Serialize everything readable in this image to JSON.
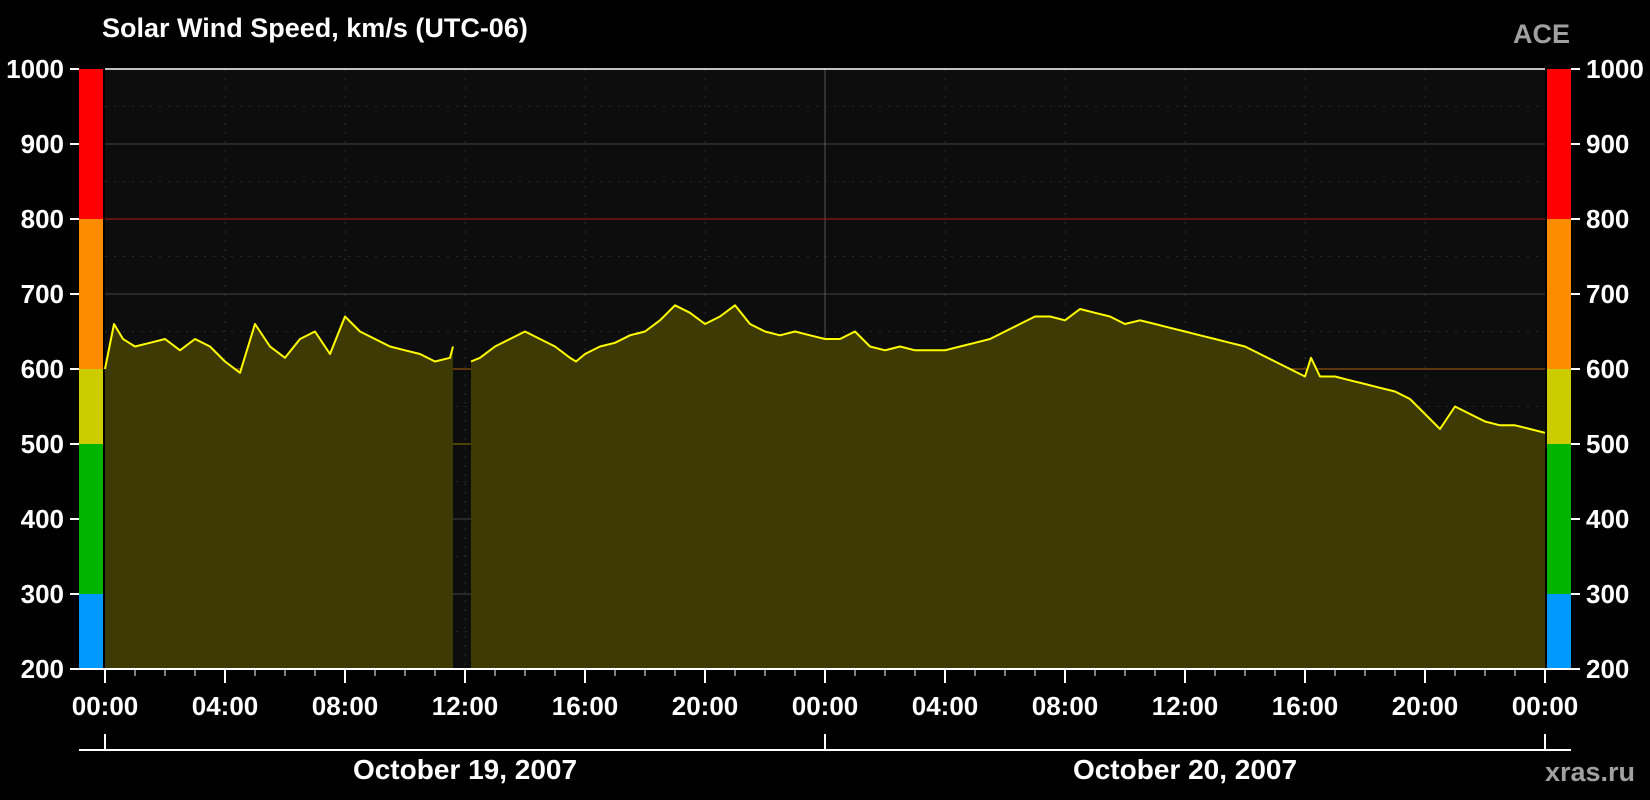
{
  "header": {
    "title": "Solar Wind Speed, km/s (UTC-06)",
    "source": "ACE"
  },
  "footer": {
    "credit": "xras.ru"
  },
  "chart_data": {
    "type": "area",
    "title": "Solar Wind Speed, km/s (UTC-06)",
    "ylim": [
      200,
      1000
    ],
    "y_ticks": [
      "200",
      "300",
      "400",
      "500",
      "600",
      "700",
      "800",
      "900",
      "1000"
    ],
    "x_range_hours": [
      0,
      48
    ],
    "x_ticks": [
      {
        "h": 0,
        "label": "00:00"
      },
      {
        "h": 4,
        "label": "04:00"
      },
      {
        "h": 8,
        "label": "08:00"
      },
      {
        "h": 12,
        "label": "12:00"
      },
      {
        "h": 16,
        "label": "16:00"
      },
      {
        "h": 20,
        "label": "20:00"
      },
      {
        "h": 24,
        "label": "00:00"
      },
      {
        "h": 28,
        "label": "04:00"
      },
      {
        "h": 32,
        "label": "08:00"
      },
      {
        "h": 36,
        "label": "12:00"
      },
      {
        "h": 40,
        "label": "16:00"
      },
      {
        "h": 44,
        "label": "20:00"
      },
      {
        "h": 48,
        "label": "00:00"
      }
    ],
    "dates": [
      {
        "label": "October 19, 2007",
        "start_h": 0,
        "end_h": 24
      },
      {
        "label": "October 20, 2007",
        "start_h": 24,
        "end_h": 48
      }
    ],
    "grid": true,
    "level_bands": [
      {
        "from": 200,
        "to": 300,
        "color": "#0099ff"
      },
      {
        "from": 300,
        "to": 500,
        "color": "#00b400"
      },
      {
        "from": 500,
        "to": 600,
        "color": "#cccc00"
      },
      {
        "from": 600,
        "to": 800,
        "color": "#ff8c00"
      },
      {
        "from": 800,
        "to": 1000,
        "color": "#ff0000"
      }
    ],
    "threshold_lines": [
      {
        "value": 500,
        "color": "#8a7a00"
      },
      {
        "value": 600,
        "color": "#b06010"
      },
      {
        "value": 800,
        "color": "#b01818"
      }
    ],
    "colors": {
      "line": "#ffff00",
      "fill": "#3d3a05",
      "plot_bg": "#0d0d0d",
      "grid": "#444444"
    },
    "series": [
      {
        "data_hours": [
          0,
          0.3,
          0.6,
          1.0,
          1.5,
          2.0,
          2.5,
          3.0,
          3.5,
          4.0,
          4.5,
          5.0,
          5.5,
          6.0,
          6.5,
          7.0,
          7.5,
          8.0,
          8.5,
          9.0,
          9.5,
          10.0,
          10.5,
          11.0,
          11.5,
          11.6,
          null,
          12.2,
          12.5,
          13.0,
          13.5,
          14.0,
          14.5,
          15.0,
          15.5,
          15.7,
          16.0,
          16.5,
          17.0,
          17.5,
          18.0,
          18.5,
          19.0,
          19.5,
          20.0,
          20.5,
          21.0,
          21.5,
          22.0,
          22.5,
          23.0,
          23.5,
          24.0,
          24.5,
          25.0,
          25.5,
          26.0,
          26.5,
          27.0,
          27.5,
          28.0,
          28.5,
          29.0,
          29.5,
          30.0,
          30.5,
          31.0,
          31.5,
          32.0,
          32.5,
          33.0,
          33.5,
          34.0,
          34.5,
          35.0,
          35.5,
          36.0,
          36.5,
          37.0,
          37.5,
          38.0,
          38.5,
          39.0,
          39.5,
          40.0,
          40.2,
          40.5,
          41.0,
          41.5,
          42.0,
          42.5,
          43.0,
          43.5,
          44.0,
          44.5,
          45.0,
          45.5,
          46.0,
          46.5,
          47.0,
          47.5,
          48.0
        ],
        "values": [
          600,
          660,
          640,
          630,
          635,
          640,
          625,
          640,
          630,
          610,
          595,
          660,
          630,
          615,
          640,
          650,
          620,
          670,
          650,
          640,
          630,
          625,
          620,
          610,
          615,
          630,
          null,
          610,
          615,
          630,
          640,
          650,
          640,
          630,
          615,
          610,
          620,
          630,
          635,
          645,
          650,
          665,
          685,
          675,
          660,
          670,
          685,
          660,
          650,
          645,
          650,
          645,
          640,
          640,
          650,
          630,
          625,
          630,
          625,
          625,
          625,
          630,
          635,
          640,
          650,
          660,
          670,
          670,
          665,
          680,
          675,
          670,
          660,
          665,
          660,
          655,
          650,
          645,
          640,
          635,
          630,
          620,
          610,
          600,
          590,
          615,
          590,
          590,
          585,
          580,
          575,
          570,
          560,
          540,
          520,
          550,
          540,
          530,
          525,
          525,
          520,
          515
        ]
      }
    ]
  }
}
